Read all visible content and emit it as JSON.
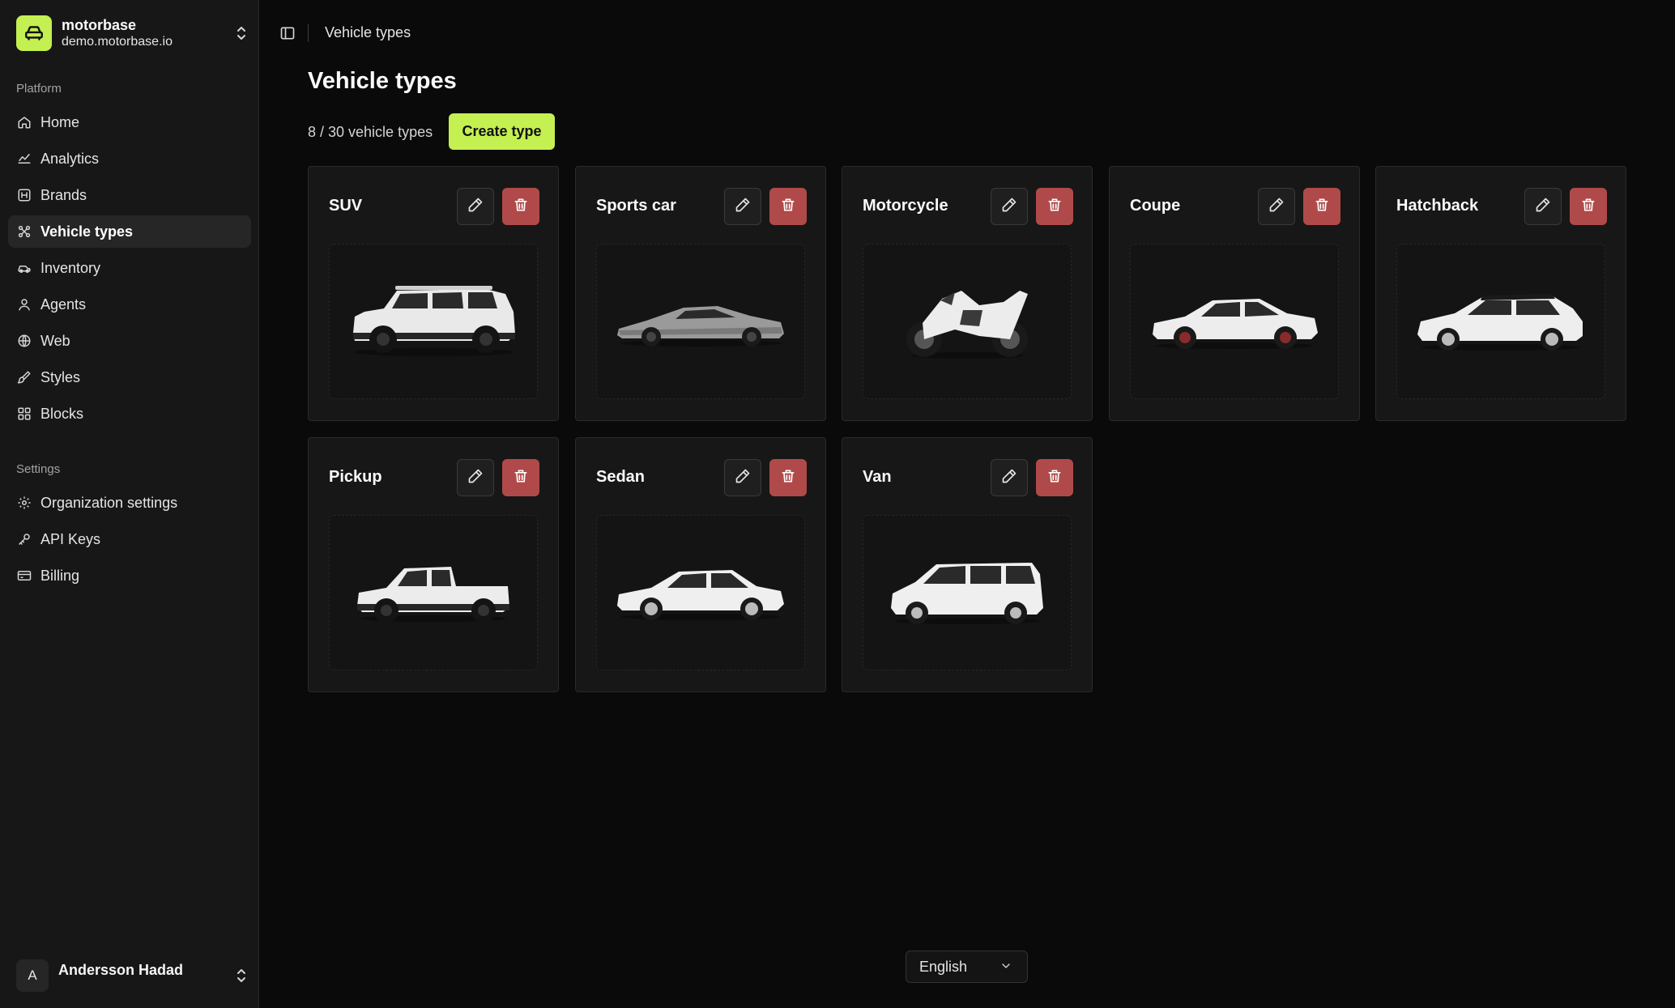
{
  "org": {
    "name": "motorbase",
    "domain": "demo.motorbase.io"
  },
  "sidebar": {
    "platform_label": "Platform",
    "platform_items": [
      {
        "label": "Home",
        "icon": "home-icon"
      },
      {
        "label": "Analytics",
        "icon": "chart-line-icon"
      },
      {
        "label": "Brands",
        "icon": "brand-icon"
      },
      {
        "label": "Vehicle types",
        "icon": "vehicle-types-icon",
        "active": true
      },
      {
        "label": "Inventory",
        "icon": "car-icon"
      },
      {
        "label": "Agents",
        "icon": "user-icon"
      },
      {
        "label": "Web",
        "icon": "globe-icon"
      },
      {
        "label": "Styles",
        "icon": "brush-icon"
      },
      {
        "label": "Blocks",
        "icon": "blocks-icon"
      }
    ],
    "settings_label": "Settings",
    "settings_items": [
      {
        "label": "Organization settings",
        "icon": "gear-icon"
      },
      {
        "label": "API Keys",
        "icon": "key-icon"
      },
      {
        "label": "Billing",
        "icon": "credit-card-icon"
      }
    ]
  },
  "user": {
    "initial": "A",
    "name": "Andersson Hadad"
  },
  "header": {
    "breadcrumb": "Vehicle types"
  },
  "main": {
    "title": "Vehicle types",
    "count": "8 / 30 vehicle types",
    "create_label": "Create type",
    "cards": [
      {
        "title": "SUV",
        "kind": "suv"
      },
      {
        "title": "Sports car",
        "kind": "sports"
      },
      {
        "title": "Motorcycle",
        "kind": "moto"
      },
      {
        "title": "Coupe",
        "kind": "coupe"
      },
      {
        "title": "Hatchback",
        "kind": "hatch"
      },
      {
        "title": "Pickup",
        "kind": "pickup"
      },
      {
        "title": "Sedan",
        "kind": "sedan"
      },
      {
        "title": "Van",
        "kind": "van"
      }
    ]
  },
  "footer": {
    "language": "English"
  },
  "colors": {
    "accent": "#c4f051",
    "danger": "#b04a4a",
    "background": "#0a0a0a",
    "sidebar": "#171717"
  }
}
